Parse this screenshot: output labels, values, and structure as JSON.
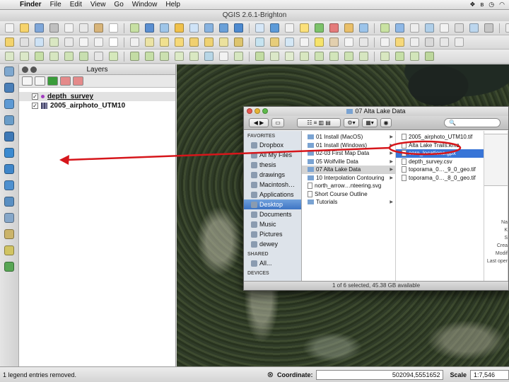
{
  "menubar": {
    "app": "Finder",
    "items": [
      "File",
      "Edit",
      "View",
      "Go",
      "Window",
      "Help"
    ]
  },
  "window_title": "QGIS 2.6.1-Brighton",
  "layers_panel": {
    "title": "Layers",
    "layers": [
      {
        "name": "depth_survey",
        "checked": true,
        "icon": "point-layer-icon"
      },
      {
        "name": "2005_airphoto_UTM10",
        "checked": true,
        "icon": "raster-layer-icon"
      }
    ]
  },
  "finder": {
    "title": "07 Alta Lake Data",
    "search_placeholder": "",
    "sidebar": {
      "favorites_header": "FAVORITES",
      "favorites": [
        "Dropbox",
        "All My Files",
        "thesis",
        "drawings",
        "Macintosh…",
        "Applications",
        "Desktop",
        "Documents",
        "Music",
        "Pictures",
        "dewey"
      ],
      "shared_header": "SHARED",
      "shared": [
        "All..."
      ],
      "devices_header": "DEVICES"
    },
    "column1": [
      "01 Install (MacOS)",
      "01 Install (Windows)",
      "02-03 First Map Data",
      "05 Wolfville Data",
      "07 Alta Lake Data",
      "10 Interpolation Contouring",
      "north_arrow…nteering.svg",
      "Short Course Outline",
      "Tutorials"
    ],
    "column2": [
      "2005_airphoto_UTM10.tif",
      "Alta Lake Trails.kmz",
      "core_locations.gpx",
      "depth_survey.csv",
      "toporama_0…_9_0_geo.tif",
      "toporama_0…_8_0_geo.tif"
    ],
    "preview_meta": [
      "Na",
      "K",
      "S",
      "Crea",
      "Modif",
      "Last oper"
    ],
    "status": "1 of 6 selected, 45.38 GB available"
  },
  "statusbar": {
    "message": "1 legend entries removed.",
    "coordinate_label": "Coordinate:",
    "coordinate_value": "502094,5551652",
    "scale_label": "Scale",
    "scale_value": "1:7,546"
  },
  "colors": {
    "annotation_red": "#d6161b",
    "selection_blue": "#3875d7"
  }
}
